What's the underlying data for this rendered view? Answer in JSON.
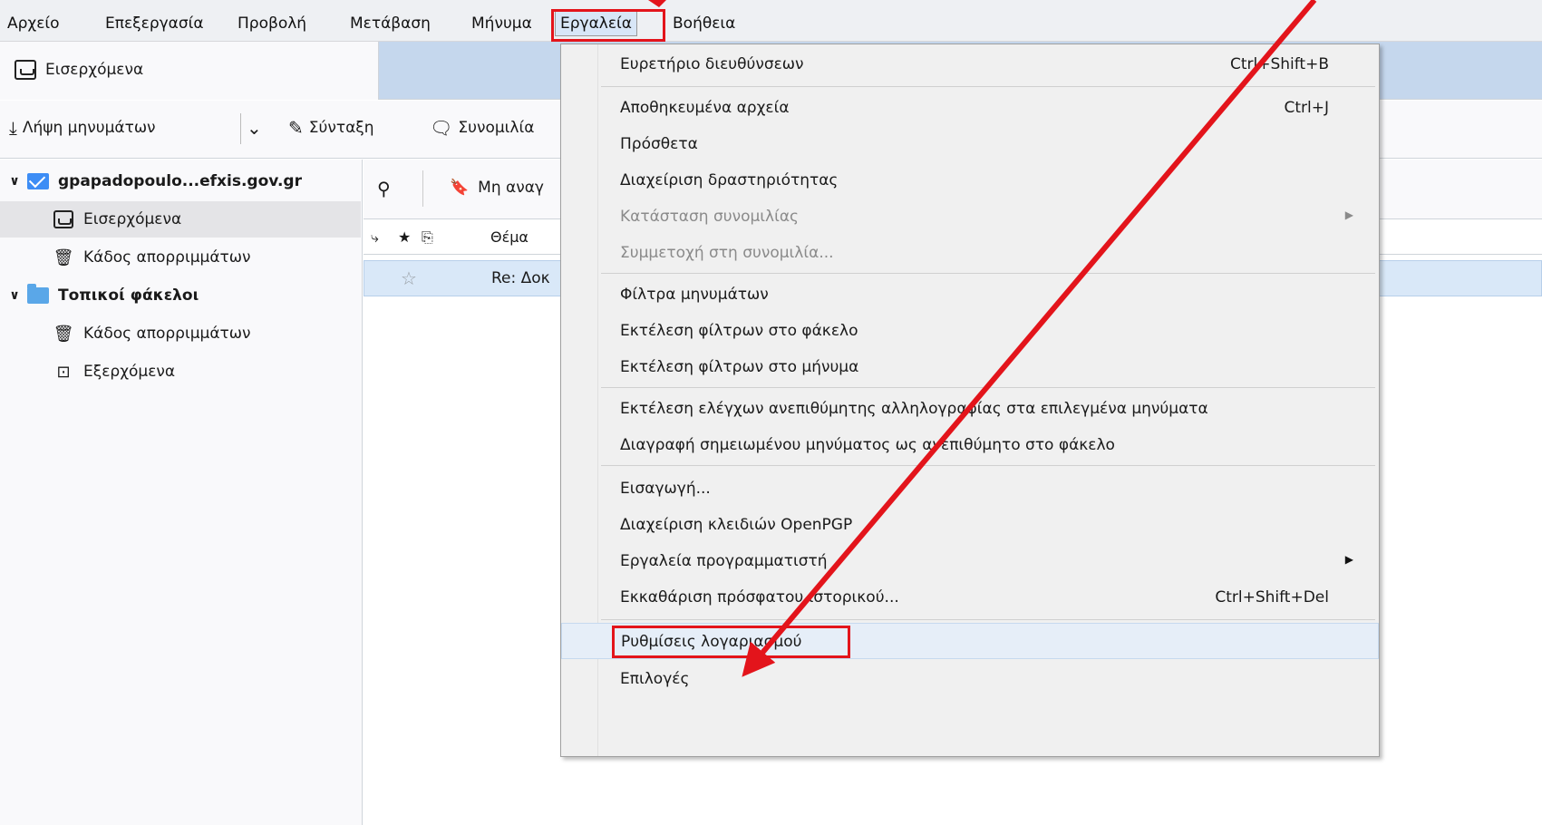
{
  "menubar": {
    "items": [
      {
        "label": "Αρχείο"
      },
      {
        "label": "Επεξεργασία"
      },
      {
        "label": "Προβολή"
      },
      {
        "label": "Μετάβαση"
      },
      {
        "label": "Μήνυμα"
      },
      {
        "label": "Εργαλεία"
      },
      {
        "label": "Βοήθεια"
      }
    ]
  },
  "tab": {
    "label": "Εισερχόμενα",
    "icon": "inbox-icon"
  },
  "toolbar": {
    "get_messages": "Λήψη μηνυμάτων",
    "compose": "Σύνταξη",
    "chat": "Συνομιλία"
  },
  "folders": {
    "account": "gpapadopoulo...efxis.gov.gr",
    "items": [
      {
        "label": "Εισερχόμενα"
      },
      {
        "label": "Κάδος απορριμμάτων"
      }
    ],
    "local": "Τοπικοί φάκελοι",
    "local_items": [
      {
        "label": "Κάδος απορριμμάτων"
      },
      {
        "label": "Εξερχόμενα"
      }
    ]
  },
  "msgpane": {
    "quickfilter_unread": "Μη αναγ",
    "col_subject": "Θέμα",
    "row_subject": "Re: Δοκ"
  },
  "menu": {
    "items": [
      {
        "label": "Ευρετήριο διευθύνσεων",
        "accel": "Ctrl+Shift+B"
      },
      {
        "label": "Αποθηκευμένα αρχεία",
        "accel": "Ctrl+J"
      },
      {
        "label": "Πρόσθετα"
      },
      {
        "label": "Διαχείριση δραστηριότητας"
      },
      {
        "label": "Κατάσταση συνομιλίας",
        "disabled": true,
        "submenu": true
      },
      {
        "label": "Συμμετοχή στη συνομιλία...",
        "disabled": true
      },
      {
        "label": "Φίλτρα μηνυμάτων"
      },
      {
        "label": "Εκτέλεση φίλτρων στο φάκελο"
      },
      {
        "label": "Εκτέλεση φίλτρων στο μήνυμα"
      },
      {
        "label": "Εκτέλεση ελέγχων ανεπιθύμητης αλληλογραφίας στα επιλεγμένα μηνύματα"
      },
      {
        "label": "Διαγραφή σημειωμένου μηνύματος ως ανεπιθύμητο στο φάκελο"
      },
      {
        "label": "Εισαγωγή..."
      },
      {
        "label": "Διαχείριση κλειδιών OpenPGP"
      },
      {
        "label": "Εργαλεία προγραμματιστή",
        "submenu": true
      },
      {
        "label": "Εκκαθάριση πρόσφατου ιστορικού...",
        "accel": "Ctrl+Shift+Del"
      },
      {
        "label": "Ρυθμίσεις λογαριασμού",
        "highlighted": true
      },
      {
        "label": "Επιλογές"
      }
    ]
  },
  "colors": {
    "annotation": "#e3141b",
    "accent": "#3d8df5"
  }
}
